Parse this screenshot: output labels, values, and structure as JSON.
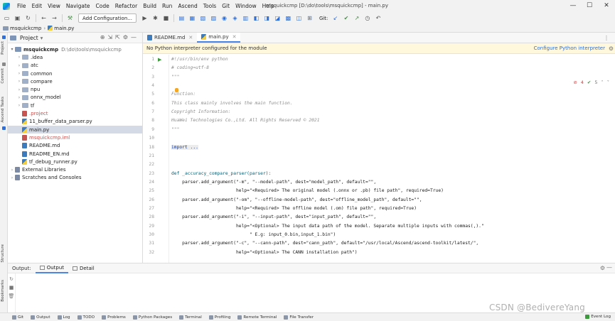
{
  "window": {
    "title": "msquickcmp [D:\\do\\tools\\msquickcmp] - main.py",
    "controls": [
      "—",
      "☐",
      "✕"
    ]
  },
  "menu": [
    "File",
    "Edit",
    "View",
    "Navigate",
    "Code",
    "Refactor",
    "Build",
    "Run",
    "Ascend",
    "Tools",
    "Git",
    "Window",
    "Help"
  ],
  "toolbar": {
    "run_config": "Add Configuration...",
    "git_label": "Git:"
  },
  "breadcrumb": {
    "project": "msquickcmp",
    "file": "main.py"
  },
  "left_stripe": {
    "project": "Project",
    "commit": "Commit",
    "ascend_tasks": "Ascend Tasks",
    "structure": "Structure",
    "bookmarks": "Bookmarks"
  },
  "project_panel": {
    "title": "Project",
    "root": {
      "name": "msquickcmp",
      "path": "D:\\do\\tools\\msquickcmp"
    },
    "items": [
      {
        "label": ".idea",
        "kind": "folder"
      },
      {
        "label": "atc",
        "kind": "folder"
      },
      {
        "label": "common",
        "kind": "folder"
      },
      {
        "label": "compare",
        "kind": "folder"
      },
      {
        "label": "npu",
        "kind": "folder"
      },
      {
        "label": "onnx_model",
        "kind": "folder"
      },
      {
        "label": "tf",
        "kind": "folder"
      },
      {
        "label": ".project",
        "kind": "red"
      },
      {
        "label": "11_buffer_data_parser.py",
        "kind": "py"
      },
      {
        "label": "main.py",
        "kind": "py"
      },
      {
        "label": "msquickcmp.iml",
        "kind": "red"
      },
      {
        "label": "README.md",
        "kind": "md"
      },
      {
        "label": "README_EN.md",
        "kind": "md"
      },
      {
        "label": "tf_debug_runner.py",
        "kind": "py"
      },
      {
        "label": "External Libraries",
        "kind": "lib"
      },
      {
        "label": "Scratches and Consoles",
        "kind": "lib"
      }
    ]
  },
  "editor": {
    "tabs": [
      {
        "label": "README.md"
      },
      {
        "label": "main.py"
      }
    ],
    "banner": {
      "message": "No Python interpreter configured for the module",
      "link": "Configure Python interpreter"
    },
    "inspections": {
      "errors": "4",
      "ok": "5"
    },
    "lines": [
      {
        "n": "1",
        "text": "#!/usr/bin/env python",
        "cls": "c-comment"
      },
      {
        "n": "2",
        "text": "# coding=utf-8",
        "cls": "c-comment"
      },
      {
        "n": "3",
        "text": "\"\"\"",
        "cls": "c-comment"
      },
      {
        "n": "4",
        "text": "",
        "cls": ""
      },
      {
        "n": "5",
        "text": "Function:",
        "cls": "c-comment"
      },
      {
        "n": "6",
        "text": "This class mainly involves the main function.",
        "cls": "c-comment"
      },
      {
        "n": "7",
        "text": "Copyright Information:",
        "cls": "c-comment"
      },
      {
        "n": "8",
        "text": "HuaWei Technologies Co.,Ltd. All Rights Reserved © 2021",
        "cls": "c-comment"
      },
      {
        "n": "9",
        "text": "\"\"\"",
        "cls": "c-comment"
      },
      {
        "n": "10",
        "text": "",
        "cls": ""
      },
      {
        "n": "18",
        "text": "import ...",
        "cls": "c-import"
      },
      {
        "n": "21",
        "text": "",
        "cls": ""
      },
      {
        "n": "22",
        "text": "",
        "cls": ""
      },
      {
        "n": "23",
        "text": "def _accuracy_compare_parser(parser):",
        "cls": "c-fn"
      },
      {
        "n": "24",
        "text": "    parser.add_argument(\"-m\", \"--model-path\", dest=\"model_path\", default=\"\",",
        "cls": ""
      },
      {
        "n": "25",
        "text": "                        help=\"<Required> The original model (.onnx or .pb) file path\", required=True)",
        "cls": ""
      },
      {
        "n": "26",
        "text": "    parser.add_argument(\"-om\", \"--offline-model-path\", dest=\"offline_model_path\", default=\"\",",
        "cls": ""
      },
      {
        "n": "27",
        "text": "                        help=\"<Required> The offline model (.om) file path\", required=True)",
        "cls": ""
      },
      {
        "n": "28",
        "text": "    parser.add_argument(\"-i\", \"--input-path\", dest=\"input_path\", default=\"\",",
        "cls": ""
      },
      {
        "n": "29",
        "text": "                        help=\"<Optional> The input data path of the model. Separate multiple inputs with commas(,).\"",
        "cls": ""
      },
      {
        "n": "30",
        "text": "                             \" E.g: input_0.bin,input_1.bin\")",
        "cls": ""
      },
      {
        "n": "31",
        "text": "    parser.add_argument(\"-c\", \"--cann-path\", dest=\"cann_path\", default=\"/usr/local/Ascend/ascend-toolkit/latest/\",",
        "cls": ""
      },
      {
        "n": "32",
        "text": "                        help=\"<Optional> The CANN installation path\")",
        "cls": ""
      }
    ]
  },
  "output_panel": {
    "title": "Output:",
    "tabs": [
      "Output",
      "Detail"
    ]
  },
  "statusbar": {
    "items": [
      "Git",
      "Output",
      "Log",
      "TODO",
      "Problems",
      "Python Packages",
      "Terminal",
      "Profiling",
      "Remote Terminal",
      "File Transfer"
    ],
    "right": "Event Log"
  },
  "watermark": "CSDN @BedivereYang"
}
